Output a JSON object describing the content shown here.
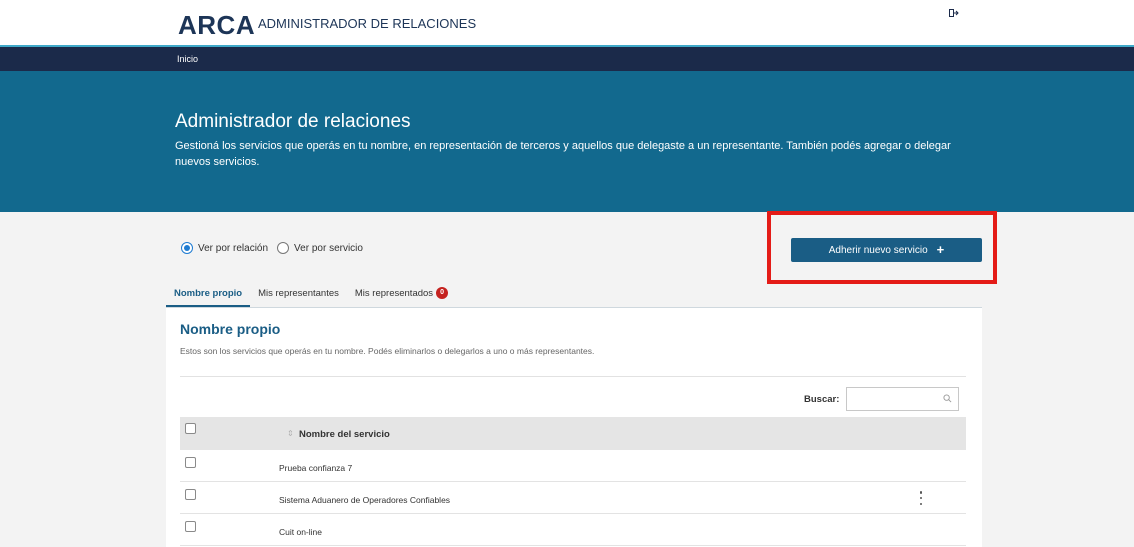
{
  "header": {
    "logo_text": "ARCA",
    "app_name": "ADMINISTRADOR DE RELACIONES"
  },
  "nav": {
    "breadcrumb_home": "Inicio"
  },
  "hero": {
    "title": "Administrador de relaciones",
    "description": "Gestioná los servicios que operás en tu nombre, en representación de terceros y aquellos que delegaste a un representante. También podés agregar o delegar nuevos servicios."
  },
  "view_options": {
    "by_relation": "Ver por relación",
    "by_service": "Ver por servicio",
    "selected": "by_relation"
  },
  "actions": {
    "add_service_label": "Adherir nuevo servicio",
    "add_service_icon": "+"
  },
  "tabs": [
    {
      "label": "Nombre propio",
      "active": true
    },
    {
      "label": "Mis representantes",
      "active": false
    },
    {
      "label": "Mis representados",
      "active": false,
      "badge": "0"
    }
  ],
  "section": {
    "title": "Nombre propio",
    "description": "Estos son los servicios que operás en tu nombre. Podés eliminarlos o delegarlos a uno o más representantes."
  },
  "search": {
    "label": "Buscar:",
    "value": ""
  },
  "table": {
    "header": {
      "sort_icon": "⇕",
      "column_name": "Nombre del servicio"
    },
    "rows": [
      {
        "name": "Prueba confianza 7"
      },
      {
        "name": "Sistema Aduanero de Operadores Confiables"
      },
      {
        "name": "Cuit on-line"
      }
    ]
  },
  "colors": {
    "brand_dark": "#1b2a4a",
    "hero_blue": "#12698e",
    "button_blue": "#1a5d85",
    "highlight_red": "#e41b17",
    "badge_red": "#c5221f"
  }
}
